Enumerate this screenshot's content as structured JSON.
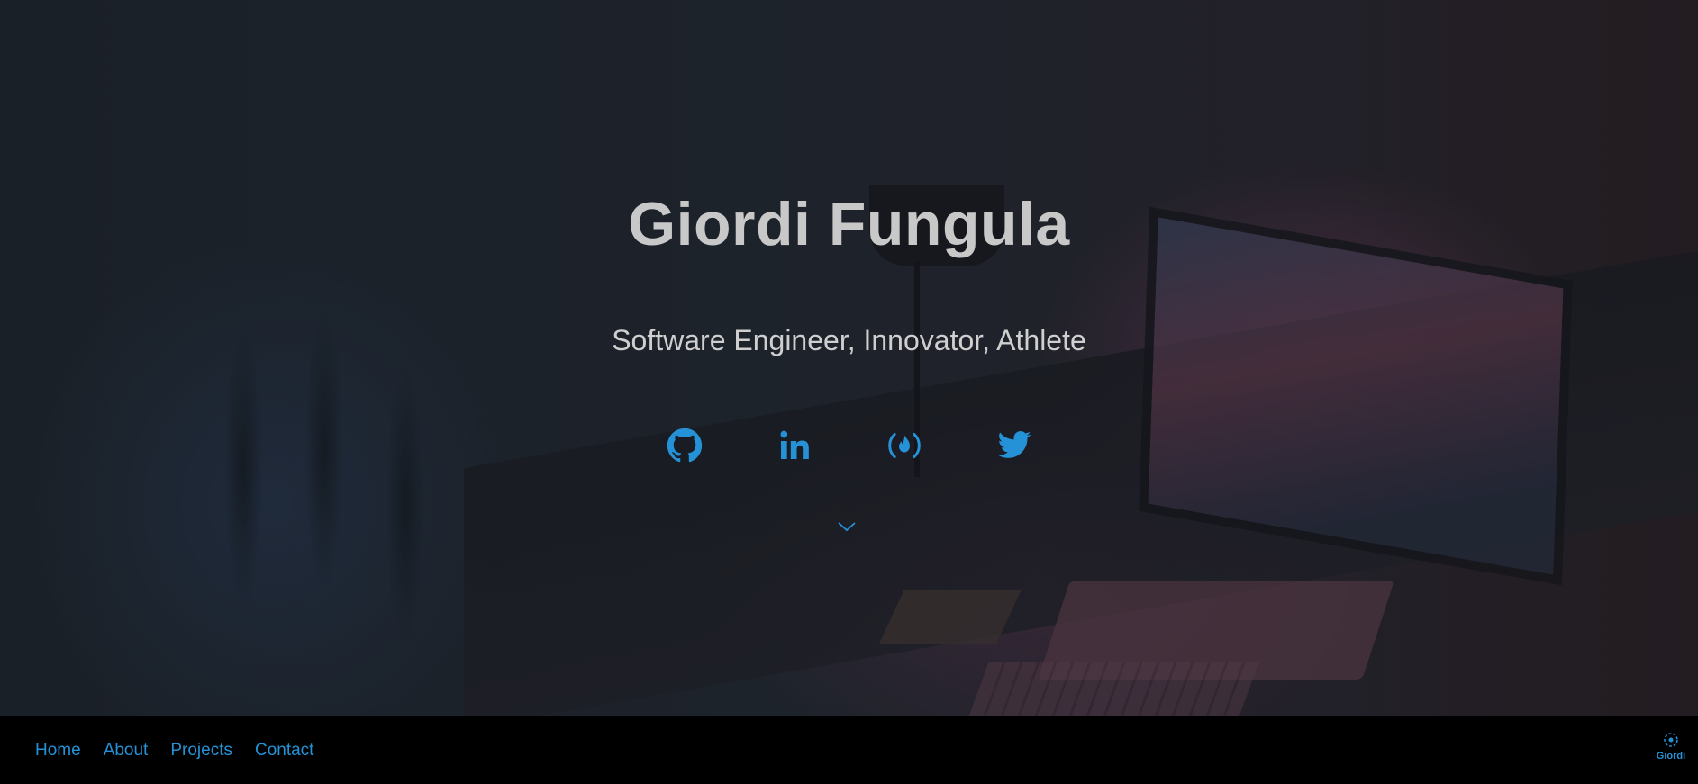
{
  "hero": {
    "title": "Giordi Fungula",
    "subtitle": "Software Engineer, Innovator, Athlete"
  },
  "socials": [
    {
      "icon": "github-icon"
    },
    {
      "icon": "linkedin-icon"
    },
    {
      "icon": "freecodecamp-icon"
    },
    {
      "icon": "twitter-icon"
    }
  ],
  "scroll": {
    "icon": "chevron-down-icon"
  },
  "nav": {
    "items": [
      {
        "label": "Home"
      },
      {
        "label": "About"
      },
      {
        "label": "Projects"
      },
      {
        "label": "Contact"
      }
    ],
    "brand": "Giordi"
  },
  "colors": {
    "accent": "#2591d6",
    "title": "#c8c8c8",
    "navbar": "#000000"
  }
}
